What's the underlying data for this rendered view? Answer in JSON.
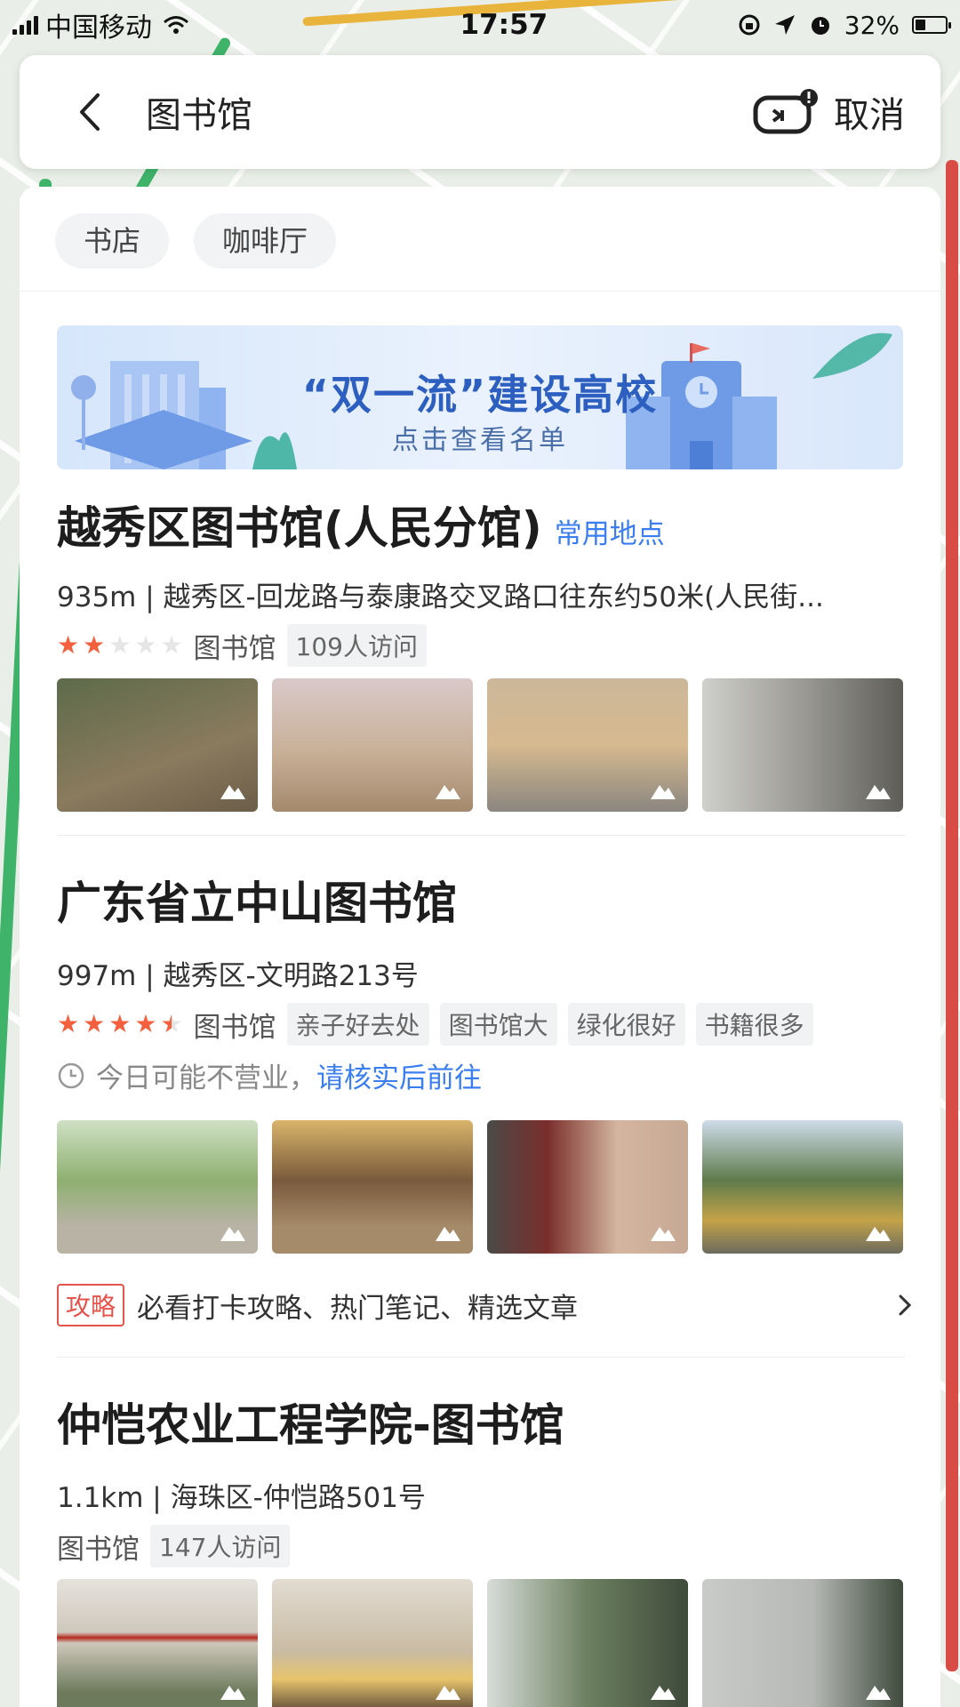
{
  "status_bar": {
    "carrier": "中国移动",
    "time": "17:57",
    "battery": "32%"
  },
  "search": {
    "query": "图书馆",
    "cancel_label": "取消"
  },
  "chips": [
    "书店",
    "咖啡厅"
  ],
  "banner": {
    "title": "“双一流”建设高校",
    "subtitle": "点击查看名单"
  },
  "results": [
    {
      "name": "越秀区图书馆(人民分馆)",
      "tag_link": "常用地点",
      "address": "935m | 越秀区-回龙路与泰康路交叉路口往东约50米(人民街...",
      "rating": 2,
      "category": "图书馆",
      "pills": [
        "109人访问"
      ],
      "photo_colors": [
        "#6b6a52",
        "#a89a84",
        "#b6a58b",
        "#8d8c86"
      ]
    },
    {
      "name": "广东省立中山图书馆",
      "address": "997m | 越秀区-文明路213号",
      "rating": 4.5,
      "category": "图书馆",
      "pills": [
        "亲子好去处",
        "图书馆大",
        "绿化很好",
        "书籍很多"
      ],
      "hours_text": "今日可能不营业，",
      "hours_link": "请核实后前往",
      "photo_colors": [
        "#8fa875",
        "#9a7a4f",
        "#8b5a4a",
        "#6f8e5e"
      ]
    },
    {
      "guide": {
        "badge": "攻略",
        "text": "必看打卡攻略、热门笔记、精选文章"
      }
    },
    {
      "name": "仲恺农业工程学院-图书馆",
      "address": "1.1km | 海珠区-仲恺路501号",
      "category": "图书馆",
      "pills": [
        "147人访问"
      ],
      "photo_colors": [
        "#c9c4bd",
        "#b8a98e",
        "#7c8a75",
        "#b9bcb8"
      ]
    }
  ],
  "colors": {
    "accent": "#3a7ef2",
    "star": "#f4603d",
    "guide": "#e5534b"
  }
}
